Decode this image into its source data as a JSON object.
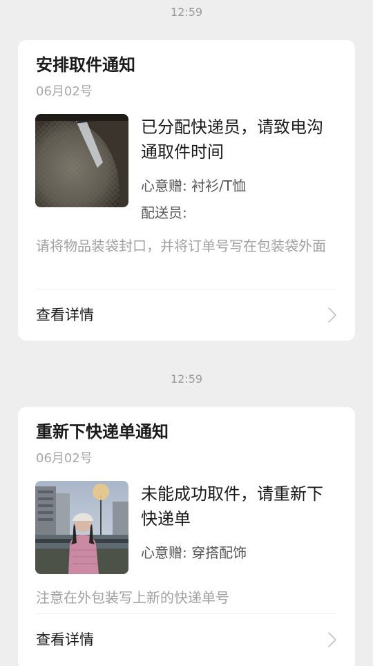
{
  "notifications": [
    {
      "time": "12:59",
      "title": "安排取件通知",
      "date": "06月02号",
      "thumbnail": "photo of a knitted sweater",
      "headline": "已分配快递员，请致电沟通取件时间",
      "item_label": "心意赠:",
      "item_value": "衬衫/T恤",
      "courier_label": "配送员:",
      "courier_value": "",
      "note": "请将物品装袋封口，并将订单号写在包装袋外面",
      "details_label": "查看详情"
    },
    {
      "time": "12:59",
      "title": "重新下快递单通知",
      "date": "06月02号",
      "thumbnail": "photo of a person outdoors",
      "headline": "未能成功取件，请重新下快递单",
      "item_label": "心意赠:",
      "item_value": "穿搭配饰",
      "note": "注意在外包装写上新的快递单号",
      "details_label": "查看详情"
    }
  ],
  "colors": {
    "background": "#eeeeee",
    "card": "#ffffff",
    "title_text": "#1a1a1a",
    "muted_text": "#a0a0a0",
    "timestamp_text": "#9a9a9a"
  },
  "icons": {
    "details_arrow": "chevron-right-icon"
  }
}
